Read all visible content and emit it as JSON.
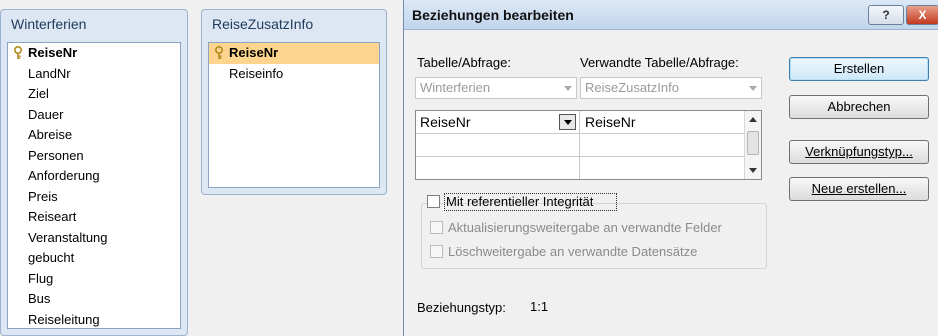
{
  "tables": {
    "winterferien": {
      "title": "Winterferien",
      "fields": [
        "ReiseNr",
        "LandNr",
        "Ziel",
        "Dauer",
        "Abreise",
        "Personen",
        "Anforderung",
        "Preis",
        "Reiseart",
        "Veranstaltung",
        "gebucht",
        "Flug",
        "Bus",
        "Reiseleitung"
      ]
    },
    "reisezusatzinfo": {
      "title": "ReiseZusatzInfo",
      "fields": [
        "ReiseNr",
        "Reiseinfo"
      ]
    }
  },
  "dialog": {
    "title": "Beziehungen bearbeiten",
    "help_label": "?",
    "close_label": "X",
    "table_label": "Tabelle/Abfrage:",
    "related_label": "Verwandte Tabelle/Abfrage:",
    "table_value": "Winterferien",
    "related_value": "ReiseZusatzInfo",
    "grid_left": "ReiseNr",
    "grid_right": "ReiseNr",
    "integrity_label": "Mit referentieller Integrität",
    "cascade_update_label": "Aktualisierungsweitergabe an verwandte Felder",
    "cascade_delete_label": "Löschweitergabe an verwandte Datensätze",
    "reltype_label": "Beziehungstyp:",
    "reltype_value": "1:1",
    "buttons": {
      "create": "Erstellen",
      "cancel": "Abbrechen",
      "join": "Verknüpfungstyp...",
      "new": "Neue erstellen..."
    }
  }
}
